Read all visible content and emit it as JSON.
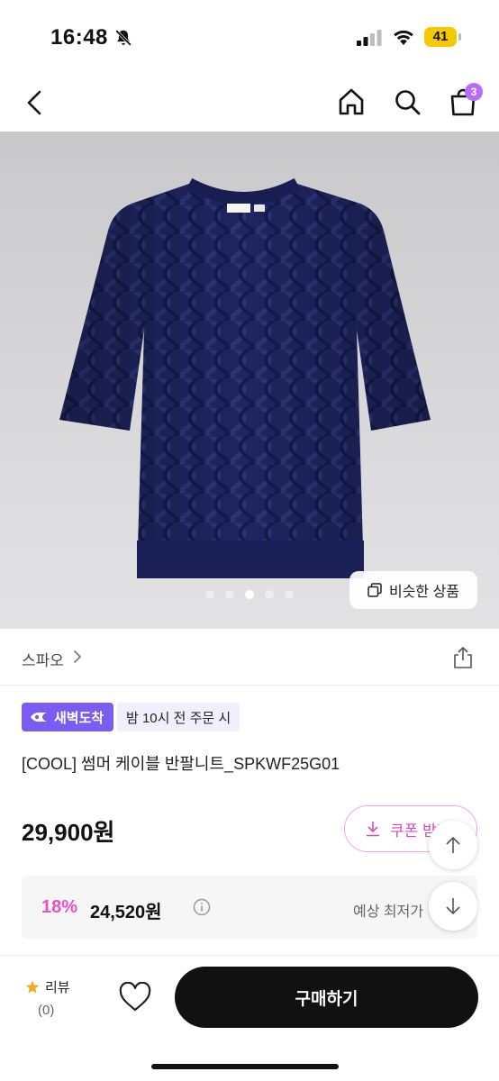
{
  "status_bar": {
    "time": "16:48",
    "battery_level": "41",
    "icons": [
      "bell-off-icon",
      "signal-icon",
      "wifi-icon",
      "battery-icon"
    ]
  },
  "nav": {
    "icons": [
      "back-icon",
      "home-icon",
      "search-icon",
      "shopping-bag-icon"
    ],
    "cart_count": "3"
  },
  "gallery": {
    "image_count": 5,
    "active_index": 2,
    "similar_button_label": "비슷한 상품"
  },
  "brand": {
    "name": "스파오"
  },
  "delivery": {
    "badge_label": "새벽도착",
    "note": "밤 10시 전 주문 시",
    "badge_color": "#7b5cf0"
  },
  "product": {
    "title": "[COOL] 썸머 케이블 반팔니트_SPKWF25G01",
    "price": "29,900원",
    "coupon_button_label": "쿠폰 받기",
    "discount_rate": "18%",
    "discount_price": "24,520원",
    "lowest_price_label": "예상 최저가",
    "accent_color": "#e84fc8"
  },
  "bottom_bar": {
    "review_label": "리뷰",
    "review_count": "(0)",
    "buy_button_label": "구매하기"
  }
}
